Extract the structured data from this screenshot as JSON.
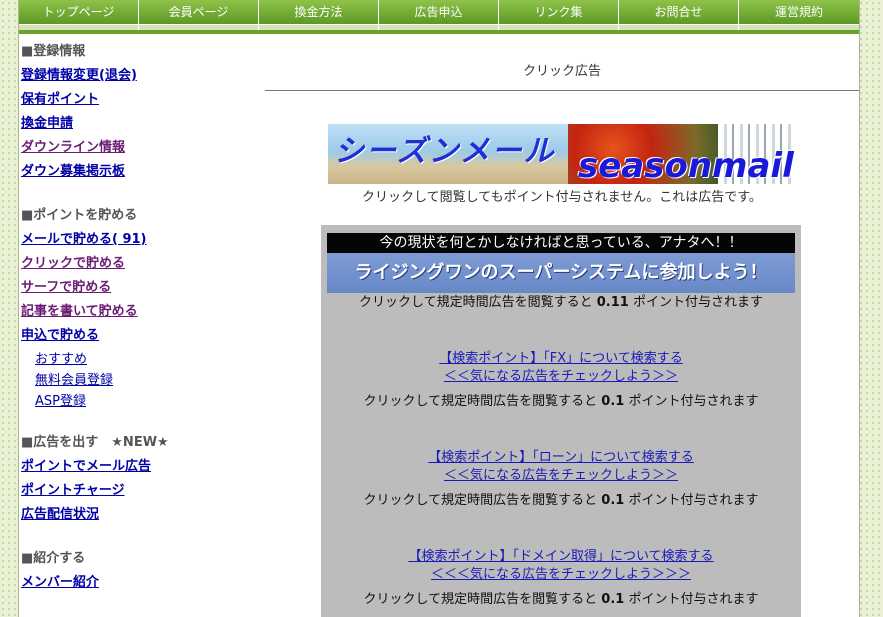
{
  "nav": {
    "items": [
      "トップページ",
      "会員ページ",
      "換金方法",
      "広告申込",
      "リンク集",
      "お問合せ",
      "運営規約"
    ]
  },
  "sidebar": {
    "sections": [
      {
        "title": "■登録情報",
        "links": [
          "登録情報変更(退会)",
          "保有ポイント",
          "換金申請",
          "ダウンライン情報",
          "ダウン募集掲示板"
        ]
      },
      {
        "title": "■ポイントを貯める",
        "links": [
          "メールで貯める( 91)",
          "クリックで貯める",
          "サーフで貯める",
          "記事を書いて貯める",
          "申込で貯める"
        ],
        "sublinks": [
          "おすすめ",
          "無料会員登録",
          "ASP登録"
        ]
      },
      {
        "title": "■広告を出す　★NEW★",
        "links": [
          "ポイントでメール広告",
          "ポイントチャージ",
          "広告配信状況"
        ]
      },
      {
        "title": "■紹介する",
        "links": [
          "メンバー紹介"
        ]
      }
    ]
  },
  "main": {
    "title": "クリック広告",
    "banner": {
      "jp": "シーズンメール",
      "en": "seasonmail"
    },
    "banner_note": "クリックして閲覧してもポイント付与されません。これは広告です。",
    "ad_banner": {
      "line1": "今の現状を何とかしなければと思っている、アナタへ！！",
      "line2": "ライジングワンのスーパーシステムに参加しよう！"
    },
    "ads": [
      {
        "note_pre": "クリックして規定時間広告を閲覧すると ",
        "points": "0.11",
        "note_post": " ポイント付与されます"
      },
      {
        "line1": "【検索ポイント】「FX」について検索する",
        "line2": "＜＜気になる広告をチェックしよう＞＞",
        "note_pre": "クリックして規定時間広告を閲覧すると ",
        "points": "0.1",
        "note_post": " ポイント付与されます"
      },
      {
        "line1": "【検索ポイント】「ローン」について検索する",
        "line2": "＜＜気になる広告をチェックしよう＞＞",
        "note_pre": "クリックして規定時間広告を閲覧すると ",
        "points": "0.1",
        "note_post": " ポイント付与されます"
      },
      {
        "line1": "【検索ポイント】「ドメイン取得」について検索する",
        "line2": "＜＜＜気になる広告をチェックしよう＞＞＞",
        "note_pre": "クリックして規定時間広告を閲覧すると ",
        "points": "0.1",
        "note_post": " ポイント付与されます"
      }
    ]
  },
  "colors": {
    "nav_green": "#4f8e1a",
    "link_blue": "#0000aa",
    "visited_purple": "#6b1c74",
    "ad_box_gray": "#bcbcbc"
  }
}
